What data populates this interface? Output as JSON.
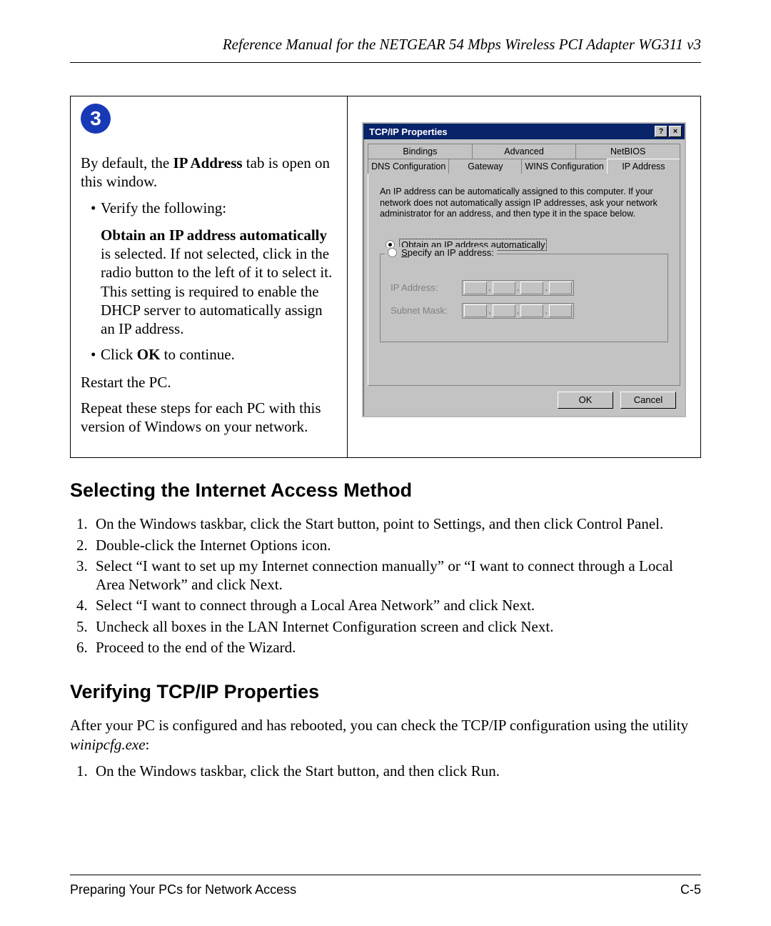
{
  "header": {
    "title": "Reference Manual for the NETGEAR 54 Mbps Wireless PCI Adapter WG311 v3"
  },
  "figure": {
    "step_number": "3",
    "left": {
      "intro_a": "By default, the ",
      "intro_bold": "IP Address",
      "intro_b": " tab is open on this window.",
      "bullet_verify": "Verify the following:",
      "para2_bold": "Obtain an IP address automatically",
      "para2_rest": " is selected. If not selected, click in the radio button to the left of it to select it. This setting is required to enable the DHCP server to automatically assign an IP address.",
      "bullet_ok_a": "Click ",
      "bullet_ok_bold": "OK",
      "bullet_ok_b": " to continue.",
      "restart": "Restart the PC.",
      "repeat": "Repeat these steps for each PC with this version of Windows on your network."
    },
    "dialog": {
      "title": "TCP/IP Properties",
      "help_btn": "?",
      "close_btn": "×",
      "tabs_row1": {
        "t1": "Bindings",
        "t2": "Advanced",
        "t3": "NetBIOS"
      },
      "tabs_row2": {
        "t1": "DNS Configuration",
        "t2": "Gateway",
        "t3": "WINS Configuration",
        "t4": "IP Address"
      },
      "info": "An IP address can be automatically assigned to this computer. If your network does not automatically assign IP addresses, ask your network administrator for an address, and then type it in the space below.",
      "radio1_ul": "O",
      "radio1_rest": "btain an IP address automatically",
      "radio2_ul": "S",
      "radio2_rest": "pecify an IP address:",
      "ip_label": "IP Address:",
      "subnet_label": "Subnet Mask:",
      "ok": "OK",
      "cancel": "Cancel"
    }
  },
  "section1": {
    "heading": "Selecting the Internet Access Method",
    "steps": [
      "On the Windows taskbar, click the Start button, point to Settings, and then click Control Panel.",
      "Double-click the Internet Options icon.",
      "Select “I want to set up my Internet connection manually” or “I want to connect through a Local Area Network” and click Next.",
      "Select “I want to connect through a Local Area Network” and click Next.",
      "Uncheck all boxes in the LAN Internet Configuration screen and click Next.",
      "Proceed to the end of the Wizard."
    ]
  },
  "section2": {
    "heading": "Verifying TCP/IP Properties",
    "para_a": "After your PC is configured and has rebooted, you can check the TCP/IP configuration using the utility ",
    "para_ital": "winipcfg.exe",
    "para_b": ":",
    "steps": [
      "On the Windows taskbar, click the Start button, and then click Run."
    ]
  },
  "footer": {
    "left": "Preparing Your PCs for Network Access",
    "right": "C-5"
  }
}
